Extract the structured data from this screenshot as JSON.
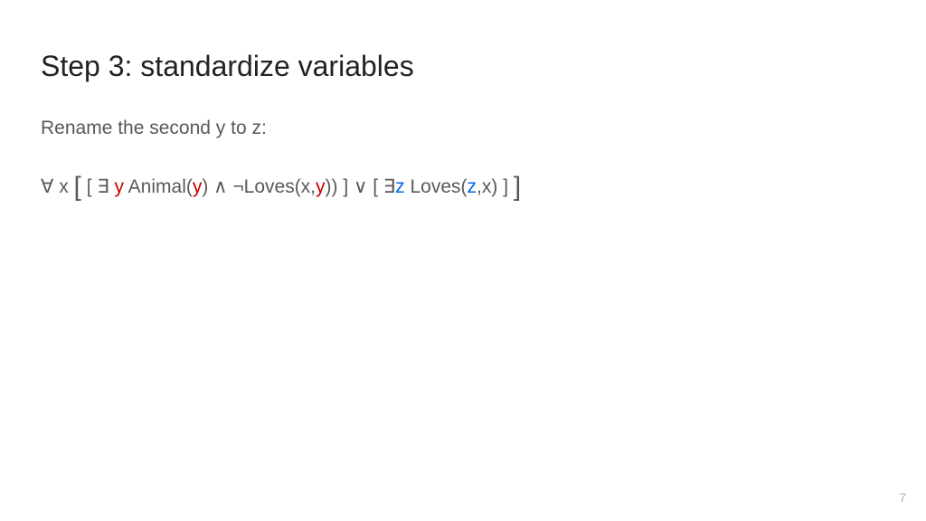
{
  "title": "Step 3: standardize variables",
  "instruction": "Rename the second y to z:",
  "formula": {
    "p1": "∀ x ",
    "bigOpen": "[",
    "p2": " [ ∃ ",
    "y1": "y",
    "p3": " Animal(",
    "y2": "y",
    "p4": ") ∧ ¬Loves(x,",
    "y3": "y",
    "p5": ")) ] ∨ [ ∃",
    "z1": "z",
    "p6": " Loves(",
    "z2": "z",
    "p7": ",x) ] ",
    "bigClose": "]"
  },
  "pageNumber": "7"
}
